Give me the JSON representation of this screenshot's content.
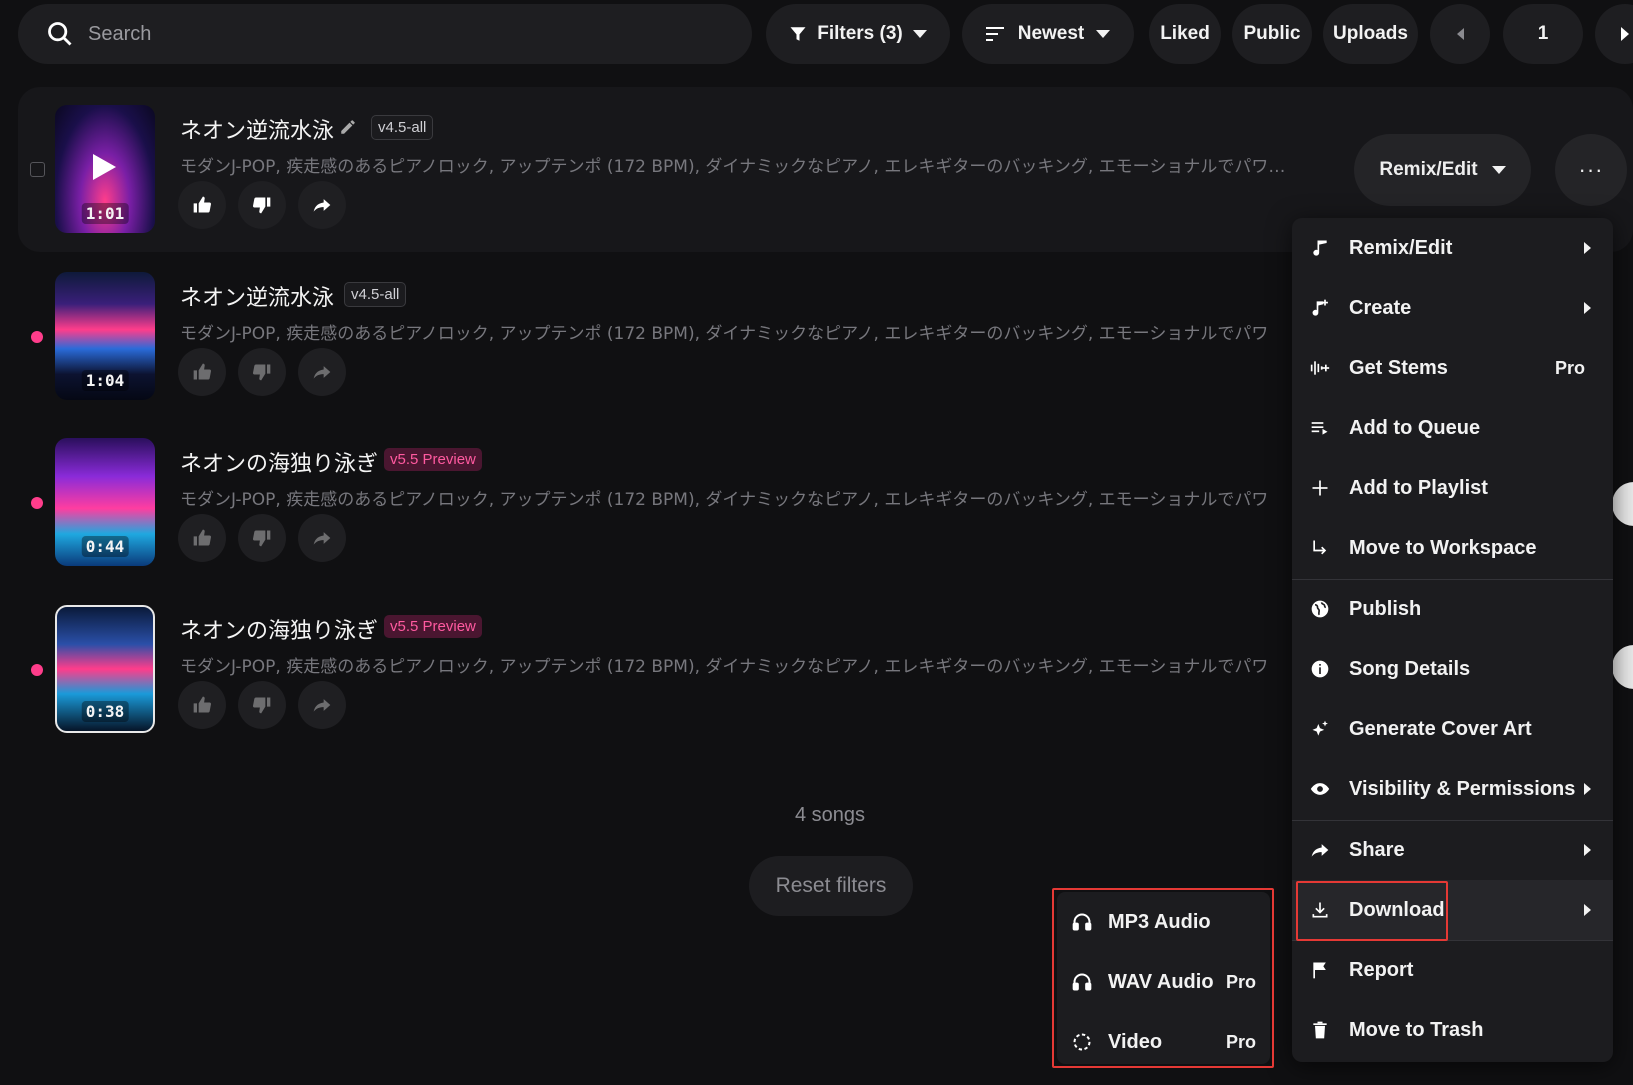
{
  "toolbar": {
    "search_placeholder": "Search",
    "filters_label": "Filters (3)",
    "sort_label": "Newest",
    "liked_label": "Liked",
    "public_label": "Public",
    "uploads_label": "Uploads",
    "page_number": "1"
  },
  "songs": [
    {
      "title": "ネオン逆流水泳",
      "version": "v4.5-all",
      "duration": "1:01",
      "description": "モダンJ-POP, 疾走感のあるピアノロック, アップテンポ (172 BPM), ダイナミックなピアノ, エレキギターのバッキング, エモーショナルでパワ…"
    },
    {
      "title": "ネオン逆流水泳",
      "version": "v4.5-all",
      "duration": "1:04",
      "description": "モダンJ-POP, 疾走感のあるピアノロック, アップテンポ (172 BPM), ダイナミックなピアノ, エレキギターのバッキング, エモーショナルでパワ"
    },
    {
      "title": "ネオンの海独り泳ぎ",
      "version": "v5.5 Preview",
      "duration": "0:44",
      "description": "モダンJ-POP, 疾走感のあるピアノロック, アップテンポ (172 BPM), ダイナミックなピアノ, エレキギターのバッキング, エモーショナルでパワ"
    },
    {
      "title": "ネオンの海独り泳ぎ",
      "version": "v5.5 Preview",
      "duration": "0:38",
      "description": "モダンJ-POP, 疾走感のあるピアノロック, アップテンポ (172 BPM), ダイナミックなピアノ, エレキギターのバッキング, エモーショナルでパワ"
    }
  ],
  "row_actions": {
    "remix_label": "Remix/Edit",
    "more_label": "···"
  },
  "footer": {
    "count": "4 songs",
    "reset_label": "Reset filters"
  },
  "menu": {
    "items": [
      {
        "label": "Remix/Edit"
      },
      {
        "label": "Create"
      },
      {
        "label": "Get Stems",
        "badge": "Pro"
      },
      {
        "label": "Add to Queue"
      },
      {
        "label": "Add to Playlist"
      },
      {
        "label": "Move to Workspace"
      },
      {
        "label": "Publish"
      },
      {
        "label": "Song Details"
      },
      {
        "label": "Generate Cover Art"
      },
      {
        "label": "Visibility & Permissions"
      },
      {
        "label": "Share"
      },
      {
        "label": "Download"
      },
      {
        "label": "Report"
      },
      {
        "label": "Move to Trash"
      }
    ]
  },
  "download_menu": {
    "items": [
      {
        "label": "MP3 Audio"
      },
      {
        "label": "WAV Audio",
        "badge": "Pro"
      },
      {
        "label": "Video",
        "badge": "Pro"
      }
    ]
  },
  "colors": {
    "background": "#101012",
    "accent_pink": "#ff3d8b",
    "highlight_red": "#e53935"
  }
}
